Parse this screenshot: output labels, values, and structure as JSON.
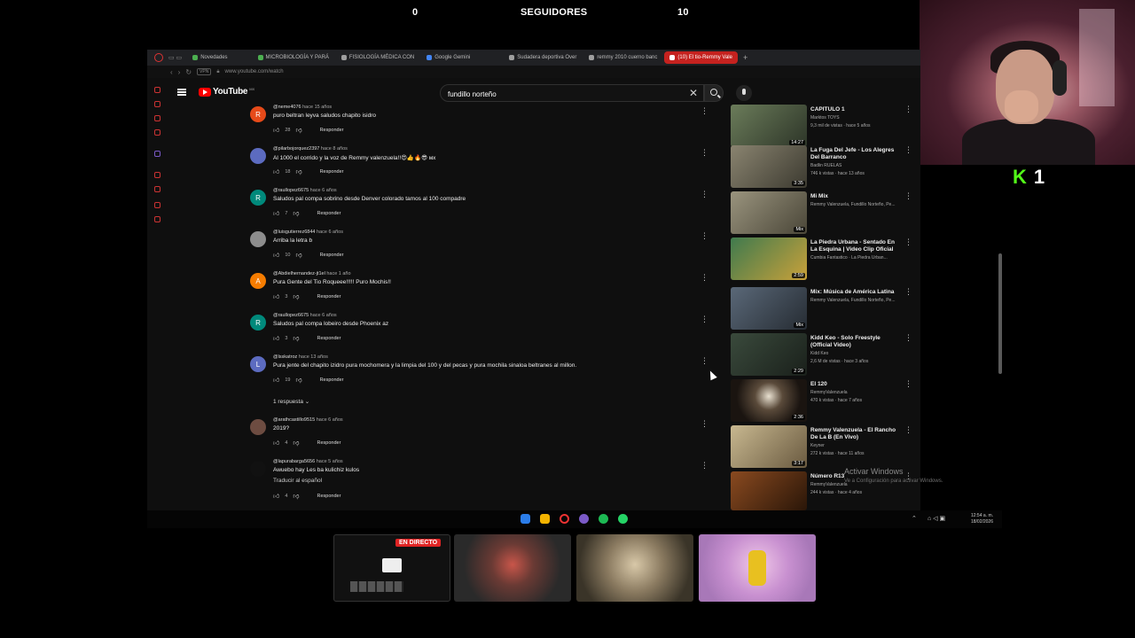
{
  "stream": {
    "left_counter": "0",
    "center_label": "SEGUIDORES",
    "right_counter": "10",
    "kick_count": "1"
  },
  "browser": {
    "tabs": [
      {
        "label": "Novedades",
        "color": "#4caf50"
      },
      {
        "label": "MICROBIOLOGÍA Y PARÁ",
        "color": "#4caf50"
      },
      {
        "label": "FISIOLOGÍA MÉDICA CON",
        "color": "#9e9e9e"
      },
      {
        "label": "Google Gemini",
        "color": "#4285f4"
      },
      {
        "label": "Sudadera deportiva Over",
        "color": "#9e9e9e"
      },
      {
        "label": "remmy 2010 cuerno banc",
        "color": "#9e9e9e"
      },
      {
        "label": "(10) El tio-Remmy Vale",
        "color": "#ff0000",
        "active": true
      }
    ],
    "url": "www.youtube.com/watch",
    "vpn_label": "VPN"
  },
  "youtube": {
    "logo_text": "YouTube",
    "country": "MX",
    "search_value": "fundillo norteño",
    "replies_toggle": "1 respuesta"
  },
  "comments": [
    {
      "avatar_letter": "R",
      "avatar_color": "#e64a19",
      "handle": "@neme4076",
      "age": "hace 15 años",
      "text": "puro beltran leyva saludos chapito isidro",
      "likes": "28",
      "reply": "Responder"
    },
    {
      "avatar_letter": "",
      "avatar_color": "#5c6bc0",
      "handle": "@pilarbojorquez2397",
      "age": "hace 8 años",
      "text": "Al 1000 el corrido y la voz de Remmy valenzuela!!😍👍🔥😎 мх",
      "likes": "18",
      "reply": "Responder"
    },
    {
      "avatar_letter": "R",
      "avatar_color": "#00897b",
      "handle": "@raullopez6675",
      "age": "hace 6 años",
      "text": "Saludos pal compa sobrino desde Denver colorado tamos al 100 compadre",
      "likes": "7",
      "reply": "Responder"
    },
    {
      "avatar_letter": "",
      "avatar_color": "#8d8d8d",
      "handle": "@luisgutierrez6844",
      "age": "hace 6 años",
      "text": "Arriba la letra b",
      "likes": "10",
      "reply": "Responder"
    },
    {
      "avatar_letter": "A",
      "avatar_color": "#f57c00",
      "handle": "@Abdielhernandez-jt1el",
      "age": "hace 1 año",
      "text": "Pura Gente del Tio Roqueee!!!!! Puro Mochis!!",
      "likes": "3",
      "reply": "Responder"
    },
    {
      "avatar_letter": "R",
      "avatar_color": "#00897b",
      "handle": "@raullopez6675",
      "age": "hace 6 años",
      "text": "Saludos pal compa lobeiro desde  Phoenix az",
      "likes": "3",
      "reply": "Responder"
    },
    {
      "avatar_letter": "L",
      "avatar_color": "#5c6bc0",
      "handle": "@lsskatroz",
      "age": "hace 13 años",
      "text": "Pura jente del chapito izidro pura mochomera y la limpia del 100 y del pecas y pura mochila sinaloa beltranes al millon.",
      "likes": "19",
      "reply": "Responder"
    },
    {
      "avatar_letter": "",
      "avatar_color": "#6d4c41",
      "handle": "@arathcastillo9515",
      "age": "hace 6 años",
      "text": "2019?",
      "likes": "4",
      "reply": "Responder"
    },
    {
      "avatar_letter": "",
      "avatar_color": "#111111",
      "handle": "@lapurabarga5656",
      "age": "hace 5 años",
      "text": "Awuebo hay Les ba kulichiz kulos",
      "text2": "Traducir al español",
      "likes": "4",
      "reply": "Responder"
    }
  ],
  "recommended": [
    {
      "title": "CAPITULO 1",
      "channel": "Marktos TOYS",
      "stats": "9,3 mil de vistas · hace 5 años",
      "duration": "14:27",
      "thumb_color": "#6b7c5a"
    },
    {
      "title": "La Fuga Del Jefe - Los Alegres Del Barranco",
      "channel": "Badlin RUELAS",
      "stats": "746 k vistas · hace 13 años",
      "duration": "3:35",
      "thumb_color": "#7a7464"
    },
    {
      "title": "Mi Mix",
      "channel": "Remmy Valenzuela, Fundillo Norteño, Pe...",
      "stats": "",
      "duration": "Mix",
      "thumb_color": "#8a8472"
    },
    {
      "title": "La Piedra Urbana - Sentado En La Esquina | Video Clip Oficial",
      "channel": "Cumbia Fantastico · La Piedra Urban...",
      "stats": "",
      "duration": "2:59",
      "thumb_color": "#3f7a4e"
    },
    {
      "title": "Mix: Música de América Latina",
      "channel": "Remmy Valenzuela, Fundillo Norteño, Pe...",
      "stats": "",
      "duration": "Mix",
      "thumb_color": "#4a5868"
    },
    {
      "title": "Kidd Keo - Solo Freestyle (Official Video)",
      "channel": "Kidd Keo",
      "stats": "2,6 M de vistas · hace 3 años",
      "duration": "2:29",
      "thumb_color": "#3a4a3c"
    },
    {
      "title": "El 120",
      "channel": "RemmyValenzuela",
      "stats": "470 k vistas · hace 7 años",
      "duration": "2:36",
      "thumb_color": "#2c2220"
    },
    {
      "title": "Remmy Valenzuela - El Rancho De La B (En Vivo)",
      "channel": "Keyner",
      "stats": "272 k vistas · hace 11 años",
      "duration": "3:17",
      "thumb_color": "#a89a78"
    },
    {
      "title": "Número R13",
      "channel": "RemmyValenzuela",
      "stats": "244 k vistas · hace 4 años",
      "duration": "",
      "thumb_color": "#6a3a20"
    }
  ],
  "windows": {
    "activate_title": "Activar Windows",
    "activate_sub": "Ve a Configuración para activar Windows.",
    "clock_time": "12:54 a. m.",
    "clock_date": "18/02/2026"
  },
  "previews": {
    "live_label": "EN DIRECTO"
  }
}
